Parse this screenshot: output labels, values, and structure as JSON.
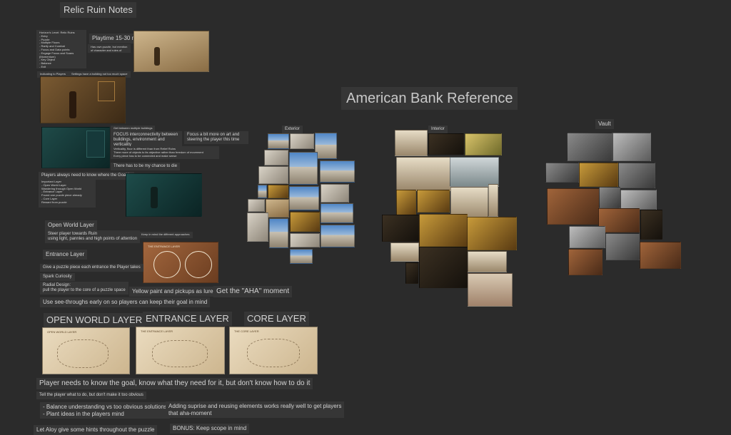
{
  "board": {
    "title_notes": "Relic Ruin Notes",
    "title_reference": "American Bank Reference"
  },
  "left": {
    "checklist": "Horizon's Level: Relic Ruins\n- Entry\n- Puzzle\n- Multiple Floors\n- Rarity and Combat\n- Focus and Data points\n- Engage Focus and Scans (Momentum)\n- Key Object\n- Balance\n- Exit\n- Recovery Area\n- Story Areas",
    "playtime": "Playtime 15-30 minutes",
    "playtime_sub": "Has own puzzle, but mention of character and rules of level",
    "caption_left": "Indicating to Players",
    "caption_right": "Settings have a building not too much space",
    "caption_teal": "Get between multiple buildings",
    "focus_interconnect": "FOCUS interconnectivity between buildings, environment and verticality",
    "focus_art": "Focus a bit more on art and steering the player this time",
    "verticality": "Verticality, floor is different than from Relief Ruins\nThere more of objects to its objective rather than freedom of movement\nEvery piece has to be connected and make sense",
    "chance_die": "There has to be my chance to die",
    "goal_know": "Players always need to know where the Goal is",
    "layers_list": "Important Layer\n- Open World Layer\n   Wandering through Open World\n- Entrance Layer\n   Found one puzzle piece already\n- Core Layer\n   Reward from puzzle",
    "open_world_layer": "Open World Layer",
    "steer_player": "Steer player towards Ruin\nusing light, pannles and high points of attention",
    "keep_mind": "Keep in mind the different approaches",
    "entrance_layer": "Entrance Layer",
    "puzzle_piece": "Give a puzzle piece each entrance the Player takes",
    "spark_curiosity": "Spark Curiosity",
    "radial_design": "Radial Design:\npull the player to the core of a puzzle space",
    "yellow_paint": "Yellow paint and pickups as lure",
    "aha_moment": "Get the \"AHA\" moment",
    "see_throughs": "Use see-throughs early on so players can keep their goal in mind",
    "entrance_sketch_title": "THE ENTRANCE LAYER"
  },
  "layers": {
    "open_world_label": "OPEN WORLD LAYER",
    "entrance_label": "ENTRANCE LAYER",
    "core_label": "CORE LAYER",
    "open_world_map": "OPEN WORLD LAYER",
    "entrance_map": "THE ENTRANCE LAYER",
    "core_map": "THE CORE LAYER"
  },
  "bottom": {
    "goal_line": "Player needs to know the goal, know what they need for it, but don't know how to do it",
    "tell_player": "Tell the player what to do, but don't make it too obvious",
    "balance": "- Balance understanding vs too obvious solutions\n- Plant ideas in the players mind",
    "surprise": "Adding suprise and reusing elements works really well to get players\nthat aha-moment",
    "aloy_hints": "Let Aloy give some hints throughout the puzzle",
    "bonus": "BONUS: Keep scope in mind"
  },
  "reference": {
    "exterior_label": "Exterior",
    "interior_label": "Interior",
    "vault_label": "Vault"
  }
}
